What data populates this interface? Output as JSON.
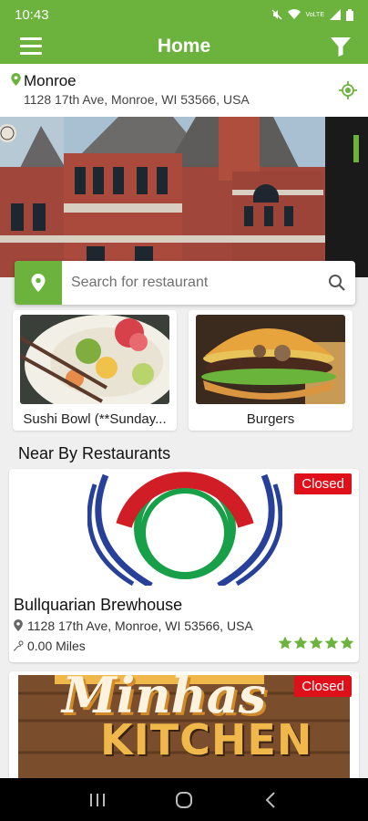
{
  "status_bar": {
    "time": "10:43",
    "network": "VoLTE"
  },
  "app_bar": {
    "title": "Home"
  },
  "location": {
    "city": "Monroe",
    "address": "1128 17th Ave, Monroe, WI 53566, USA"
  },
  "search": {
    "placeholder": "Search for restaurant"
  },
  "categories": [
    {
      "label": "Sushi Bowl (**Sunday..."
    },
    {
      "label": "Burgers"
    }
  ],
  "section": {
    "title": "Near By Restaurants"
  },
  "restaurants": [
    {
      "name": "Bullquarian Brewhouse",
      "address": "1128 17th Ave, Monroe, WI 53566, USA",
      "distance": "0.00 Miles",
      "status": "Closed",
      "rating": 5
    },
    {
      "logo_line1": "Minhas",
      "logo_line2": "KITCHEN",
      "status": "Closed"
    }
  ],
  "colors": {
    "brand_green": "#6cb33e",
    "closed_red": "#e0101a"
  }
}
